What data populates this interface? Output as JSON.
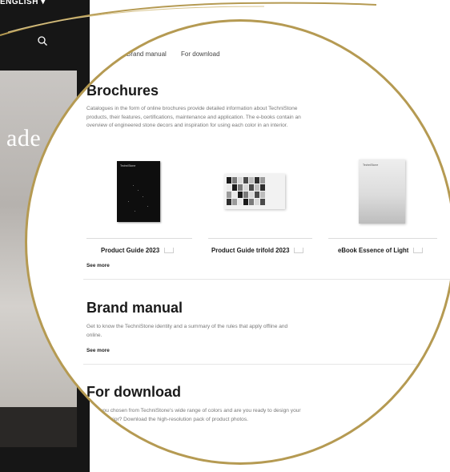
{
  "site": {
    "language": "ENGLISH",
    "hero_text": "ade"
  },
  "breadcrumb": [
    "Brand manual",
    "For download"
  ],
  "brochures": {
    "title": "Brochures",
    "description": "Catalogues in the form of online brochures provide detailed information about TechniStone products, their features, certifications, maintenance and application. The e-books contain an overview of engineered stone decors and inspiration for using each color in an interior.",
    "items": [
      {
        "title": "Product Guide 2023",
        "cover_label": "TechniStone"
      },
      {
        "title": "Product Guide trifold 2023",
        "cover_label": ""
      },
      {
        "title": "eBook Essence of Light",
        "cover_label": "TechniStone"
      }
    ],
    "see_more": "See more"
  },
  "brand_manual": {
    "title": "Brand manual",
    "description": "Get to know the TechniStone identity and a summary of the rules that apply offline and online.",
    "see_more": "See more"
  },
  "for_download": {
    "title": "For download",
    "description": "Have you chosen from TechniStone's wide range of colors and are you ready to design your dream interior? Download the high-resolution pack of product photos."
  },
  "colors": {
    "accent_gold": "#b59a52",
    "dark_bg": "#161616"
  }
}
